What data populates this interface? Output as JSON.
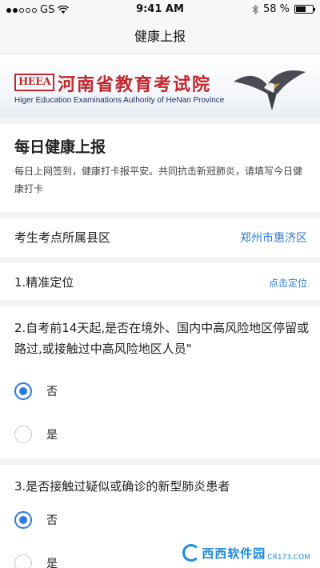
{
  "status_bar": {
    "carrier": "GS",
    "time": "9:41 AM",
    "battery_text": "58 %",
    "battery_level": 0.58
  },
  "nav": {
    "title": "健康上报"
  },
  "banner": {
    "logo_text": "HEEA",
    "title": "河南省教育考试院",
    "subtitle": "Higer Education Examinations Authority of HeNan Province"
  },
  "intro": {
    "title": "每日健康上报",
    "description": "每日上网签到，健康打卡报平安。共同抗击新冠肺炎，请填写今日健康打卡"
  },
  "county": {
    "label": "考生考点所属县区",
    "value": "郑州市惠济区"
  },
  "locate": {
    "label": "1.精准定位",
    "action": "点击定位"
  },
  "questions": [
    {
      "title": "2.自考前14天起,是否在境外、国内中高风险地区停留或路过,或接触过中高风险地区人员\"",
      "options": [
        {
          "label": "否",
          "checked": true
        },
        {
          "label": "是",
          "checked": false
        }
      ]
    },
    {
      "title": "3.是否接触过疑似或确诊的新型肺炎患者",
      "options": [
        {
          "label": "否",
          "checked": true
        },
        {
          "label": "是",
          "checked": false
        }
      ]
    }
  ],
  "watermark": {
    "text": "西西软件园",
    "url": "CR173.COM"
  },
  "colors": {
    "accent": "#2a7ae2",
    "brand_red": "#c0282d"
  }
}
